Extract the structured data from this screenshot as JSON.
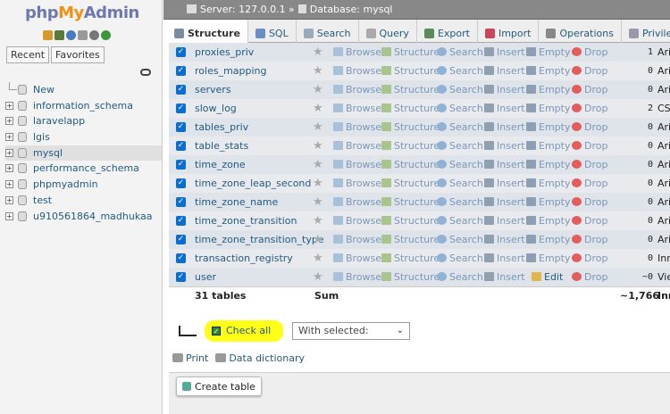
{
  "sidebar": {
    "logo": {
      "php": "php",
      "my": "My",
      "admin": "Admin"
    },
    "icons": [
      "home-icon",
      "exit-icon",
      "help-icon",
      "docs-icon",
      "settings-icon",
      "reload-icon"
    ],
    "recent_label": "Recent",
    "favorites_label": "Favorites",
    "tree": [
      {
        "label": "New",
        "expandable": false,
        "selected": false
      },
      {
        "label": "information_schema",
        "expandable": true,
        "selected": false
      },
      {
        "label": "laravelapp",
        "expandable": true,
        "selected": false
      },
      {
        "label": "lgis",
        "expandable": true,
        "selected": false
      },
      {
        "label": "mysql",
        "expandable": true,
        "selected": true
      },
      {
        "label": "performance_schema",
        "expandable": true,
        "selected": false
      },
      {
        "label": "phpmyadmin",
        "expandable": true,
        "selected": false
      },
      {
        "label": "test",
        "expandable": true,
        "selected": false
      },
      {
        "label": "u910561864_madhukaa",
        "expandable": true,
        "selected": false
      }
    ]
  },
  "breadcrumb": {
    "server": "Server: 127.0.0.1 »",
    "database": "Database: mysql"
  },
  "tabs": [
    {
      "label": "Structure",
      "active": true
    },
    {
      "label": "SQL",
      "active": false
    },
    {
      "label": "Search",
      "active": false
    },
    {
      "label": "Query",
      "active": false
    },
    {
      "label": "Export",
      "active": false
    },
    {
      "label": "Import",
      "active": false
    },
    {
      "label": "Operations",
      "active": false
    },
    {
      "label": "Privile",
      "active": false
    }
  ],
  "actions": {
    "browse": "Browse",
    "structure": "Structure",
    "search": "Search",
    "insert": "Insert",
    "empty": "Empty",
    "drop": "Drop",
    "edit": "Edit"
  },
  "tables": [
    {
      "name": "proxies_priv",
      "rows": "1",
      "engine": "Aria"
    },
    {
      "name": "roles_mapping",
      "rows": "0",
      "engine": "Aria"
    },
    {
      "name": "servers",
      "rows": "0",
      "engine": "Aria"
    },
    {
      "name": "slow_log",
      "rows": "2",
      "engine": "CSV"
    },
    {
      "name": "tables_priv",
      "rows": "0",
      "engine": "Aria"
    },
    {
      "name": "table_stats",
      "rows": "0",
      "engine": "Aria"
    },
    {
      "name": "time_zone",
      "rows": "0",
      "engine": "Aria"
    },
    {
      "name": "time_zone_leap_second",
      "rows": "0",
      "engine": "Aria"
    },
    {
      "name": "time_zone_name",
      "rows": "0",
      "engine": "Aria"
    },
    {
      "name": "time_zone_transition",
      "rows": "0",
      "engine": "Aria"
    },
    {
      "name": "time_zone_transition_type",
      "rows": "0",
      "engine": "Aria"
    },
    {
      "name": "transaction_registry",
      "rows": "0",
      "engine": "Inno"
    },
    {
      "name": "user",
      "rows": "~0",
      "engine": "View"
    }
  ],
  "summary": {
    "count": "31 tables",
    "sum_label": "Sum",
    "total": "~1,766",
    "engine": "Inno"
  },
  "footer": {
    "check_all": "Check all",
    "with_selected": "With selected:",
    "print": "Print",
    "data_dictionary": "Data dictionary",
    "create_table": "Create table"
  }
}
